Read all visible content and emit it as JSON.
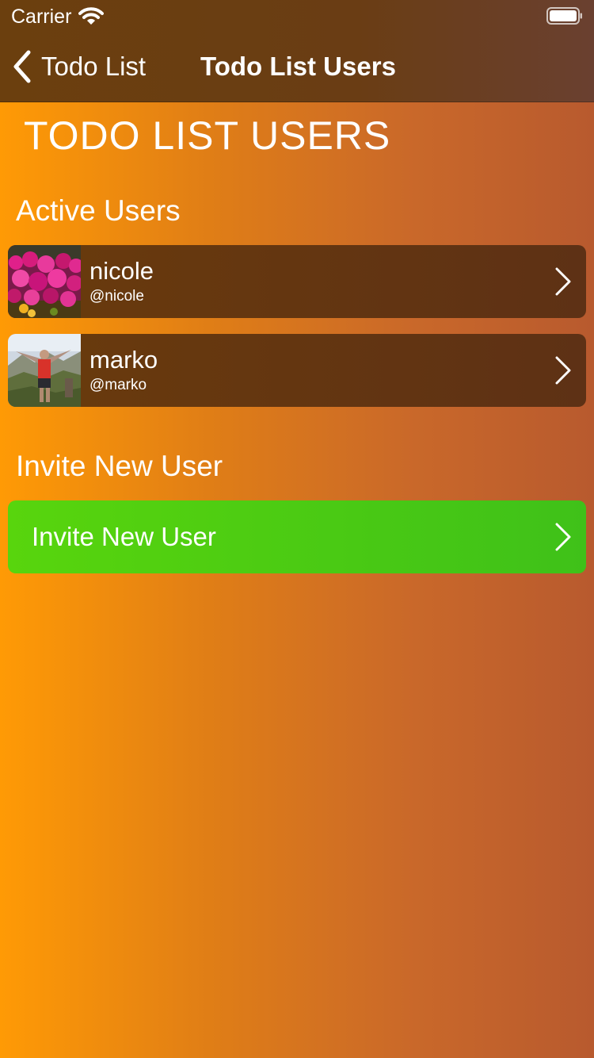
{
  "status_bar": {
    "carrier": "Carrier",
    "wifi_icon": "wifi-icon",
    "battery_icon": "battery-icon"
  },
  "nav": {
    "back_label": "Todo List",
    "title": "Todo List Users"
  },
  "page": {
    "heading": "TODO LIST USERS"
  },
  "active_users": {
    "title": "Active Users",
    "items": [
      {
        "name": "nicole",
        "handle": "@nicole",
        "avatar": "flower-photo"
      },
      {
        "name": "marko",
        "handle": "@marko",
        "avatar": "mountain-photo"
      }
    ]
  },
  "invite": {
    "title": "Invite New User",
    "button_label": "Invite New User"
  },
  "colors": {
    "background_start": "#ff9a05",
    "background_end": "#b85a2e",
    "bar": "#6b3f0e",
    "row": "#6a3b0c",
    "invite_green": "#58d50d",
    "text": "#ffffff"
  }
}
